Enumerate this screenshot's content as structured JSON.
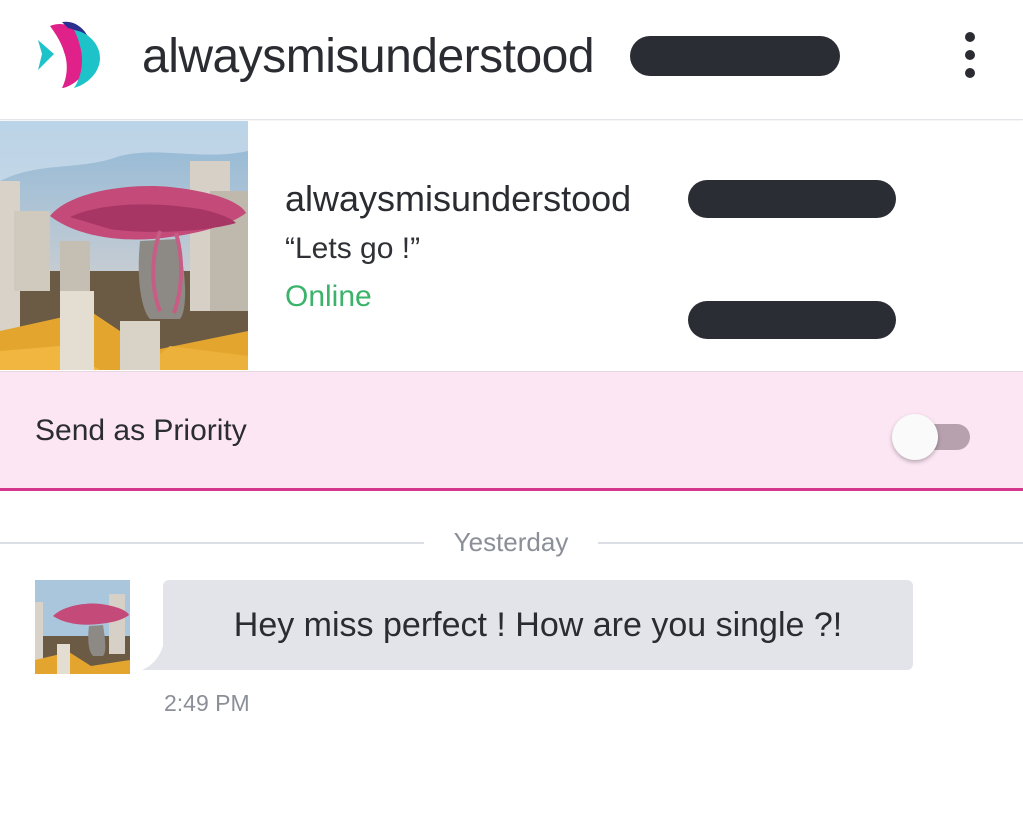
{
  "header": {
    "title": "alwaysmisunderstood",
    "logo_icon": "fish-logo-icon",
    "menu_icon": "more-vertical-icon"
  },
  "profile": {
    "name": "alwaysmisunderstood",
    "status_message": "“Lets go !”",
    "presence": "Online"
  },
  "priority": {
    "label": "Send as Priority",
    "enabled": false
  },
  "conversation": {
    "date_divider": "Yesterday",
    "messages": [
      {
        "text": "Hey miss perfect ! How are you single ?!",
        "time": "2:49 PM"
      }
    ]
  },
  "colors": {
    "online": "#3bb36a",
    "priority_bg": "#fce6f4",
    "priority_accent": "#d4378d",
    "bubble_bg": "#e2e4ea"
  }
}
